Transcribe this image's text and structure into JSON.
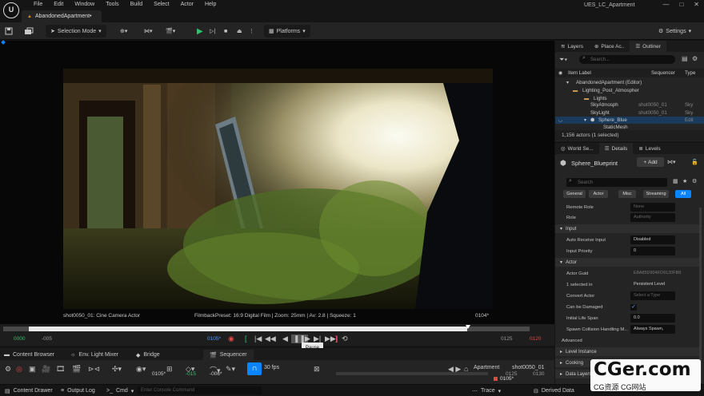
{
  "titlebar": {
    "app_logo": "U",
    "menu": [
      "File",
      "Edit",
      "Window",
      "Tools",
      "Build",
      "Select",
      "Actor",
      "Help"
    ],
    "doc_tab": "AbandonedApartment•",
    "window_title": "UES_LC_Apartment",
    "buttons": [
      "—",
      "□",
      "✕"
    ]
  },
  "toolbar": {
    "selection_mode": "Selection Mode",
    "platforms": "Platforms",
    "settings": "Settings"
  },
  "viewport": {
    "camera_actor": "shot0050_01: Cine Camera Actor",
    "filmback": "FilmbackPreset: 16:9 Digital Film | Zoom: 25mm | Av: 2.8 | Squeeze: 1",
    "frame": "0104*"
  },
  "sequencer": {
    "time_start": "0000",
    "time_start2": "-005",
    "current": "0105*",
    "end1": "0125",
    "end2": "0120",
    "tooltip": "Pause",
    "fps": "30 fps",
    "frame_pos": "0105*",
    "neg1": "-015",
    "neg2": "-006*",
    "breadcrumb": "Apartment",
    "shot": "shot0050_01",
    "bottom_frames": [
      "0125",
      "0130"
    ],
    "marker": "0105*"
  },
  "bottom_tabs": [
    "Content Browser",
    "Env. Light Mixer",
    "Bridge",
    "Sequencer"
  ],
  "statusbar": {
    "content_drawer": "Content Drawer",
    "output_log": "Output Log",
    "cmd": "Cmd",
    "console_placeholder": "Enter Console Command",
    "trace": "Trace",
    "derived": "Derived Data"
  },
  "outliner": {
    "tabs": [
      "Layers",
      "Place Ac..",
      "Outliner"
    ],
    "search_placeholder": "Search...",
    "headers": [
      "Item Label",
      "Sequencer",
      "Type"
    ],
    "rows": [
      {
        "label": "AbandonedApartment (Editor)",
        "col2": "",
        "col3": ""
      },
      {
        "label": "Lighting_Post_Atmospher",
        "col2": "",
        "col3": ""
      },
      {
        "label": "Lights",
        "col2": "",
        "col3": ""
      },
      {
        "label": "SkyAtmosph",
        "col2": "shot0050_01",
        "col3": "Sky"
      },
      {
        "label": "SkyLight",
        "col2": "shot0050_01",
        "col3": "Sky"
      },
      {
        "label": "Sphere_Blue",
        "col2": "",
        "col3": "Edit"
      },
      {
        "label": "StaticMesh",
        "col2": "",
        "col3": ""
      }
    ],
    "count": "1,156 actors (1 selected)"
  },
  "details": {
    "tabs": [
      "World Se...",
      "Details",
      "Levels"
    ],
    "actor_name": "Sphere_Blueprint",
    "add_label": "Add",
    "search_placeholder": "Search",
    "filters": [
      "General",
      "Actor",
      "Misc",
      "Streaming",
      "All"
    ],
    "remote_role": {
      "label": "Remote Role",
      "value": "None"
    },
    "role": {
      "label": "Role",
      "value": "Authority"
    },
    "input_section": "Input",
    "auto_receive": {
      "label": "Auto Receive Input",
      "value": "Disabled"
    },
    "input_priority": {
      "label": "Input Priority",
      "value": "0"
    },
    "actor_section": "Actor",
    "actor_guid": {
      "label": "Actor Guid",
      "value": "E8A85D904FD9120FB8"
    },
    "selected_in": {
      "label": "1 selected in",
      "value": "Persistent Level"
    },
    "convert_actor": {
      "label": "Convert Actor",
      "value": "Select a Type"
    },
    "can_be_damaged": "Can be Damaged",
    "initial_life": {
      "label": "Initial Life Span",
      "value": "0.0"
    },
    "spawn_collision": {
      "label": "Spawn Collision Handling M...",
      "value": "Always Spawn,"
    },
    "advanced": "Advanced",
    "sections_collapsed": [
      "Level Instance",
      "Cooking",
      "Data Layers"
    ]
  },
  "watermark": {
    "big": "CGer.com",
    "small": "CG资源 CG网站"
  },
  "colors": {
    "accent": "#0a84ff",
    "bg": "#151515",
    "panel": "#242424",
    "green": "#2fc26a",
    "red": "#e04848"
  }
}
